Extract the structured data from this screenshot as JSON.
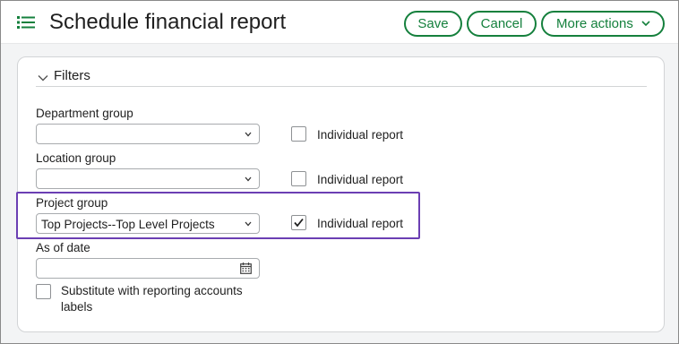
{
  "header": {
    "title": "Schedule financial report",
    "menu_icon": "list-icon",
    "actions": {
      "save_label": "Save",
      "cancel_label": "Cancel",
      "more_label": "More actions"
    },
    "accent_color": "#15803d"
  },
  "filters": {
    "section_title": "Filters",
    "fields": [
      {
        "label": "Department group",
        "value": "",
        "individual_label": "Individual report",
        "individual_checked": false
      },
      {
        "label": "Location group",
        "value": "",
        "individual_label": "Individual report",
        "individual_checked": false
      },
      {
        "label": "Project group",
        "value": "Top Projects--Top Level Projects",
        "individual_label": "Individual report",
        "individual_checked": true
      }
    ],
    "as_of_date": {
      "label": "As of date",
      "value": ""
    },
    "substitute": {
      "label": "Substitute with reporting accounts labels",
      "checked": false
    },
    "highlight_color": "#6b3fb3"
  }
}
